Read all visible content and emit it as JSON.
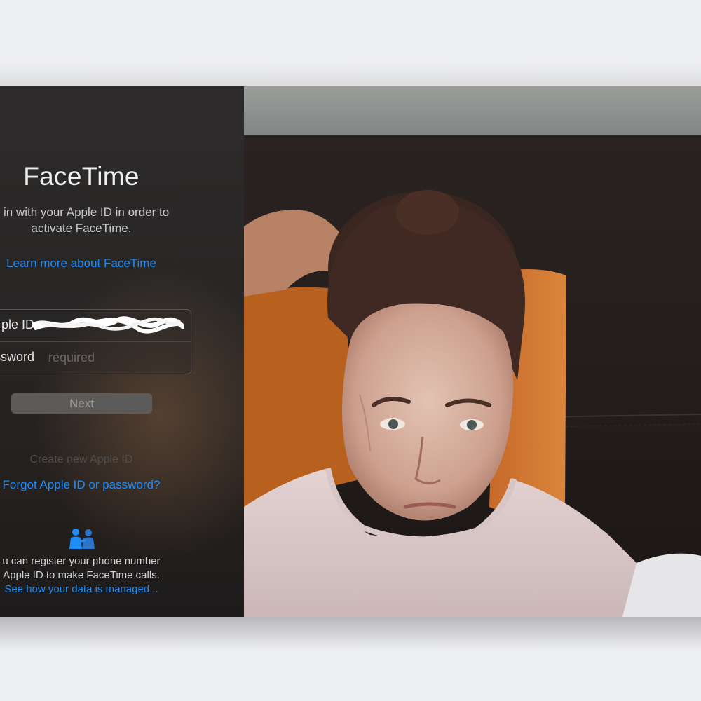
{
  "app": {
    "title": "FaceTime",
    "subtitle_line1": "n in with your Apple ID in order to",
    "subtitle_line2": "activate FaceTime.",
    "learn_more": "Learn more about FaceTime"
  },
  "form": {
    "apple_id_label": "ple ID",
    "apple_id_value": "",
    "password_label": "ssword",
    "password_placeholder": "required"
  },
  "buttons": {
    "next": "Next"
  },
  "links": {
    "create": "Create new Apple ID",
    "forgot": "Forgot Apple ID or password?",
    "data": "See how your data is managed..."
  },
  "info": {
    "line1": "u can register your phone number",
    "line2": "Apple ID to make FaceTime calls."
  },
  "icons": {
    "people": "people-icon"
  },
  "colors": {
    "link": "#1f8cf7",
    "panel": "#2a2827"
  }
}
